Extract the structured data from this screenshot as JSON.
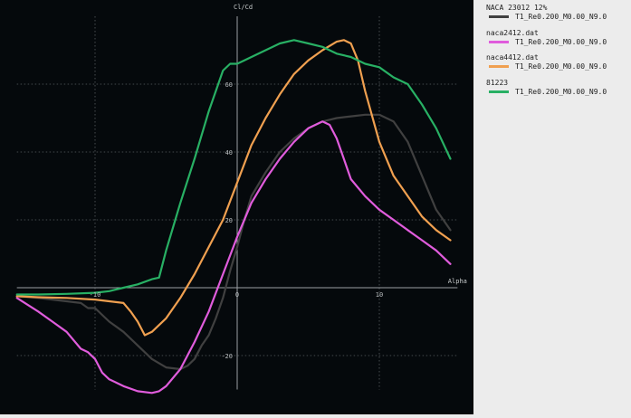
{
  "chart_data": {
    "type": "line",
    "xlabel": "Alpha",
    "ylabel": "Cl/Cd",
    "xlim": [
      -15.5,
      15.5
    ],
    "ylim": [
      -30,
      80
    ],
    "x_ticks": [
      -10,
      0,
      10
    ],
    "y_ticks": [
      -20,
      20,
      60
    ],
    "extra_tick_labels": [
      {
        "axis": "y",
        "value": 40,
        "text": "40"
      }
    ],
    "grid": true,
    "legend_position": "right",
    "background": "#05090c",
    "series": [
      {
        "name": "NACA 23012  12%",
        "polar": "T1_Re0.200_M0.00_N9.0",
        "color": "#404040",
        "x": [
          -15.5,
          -14,
          -12,
          -11,
          -10.5,
          -10,
          -9.5,
          -9,
          -8,
          -7,
          -6,
          -5,
          -4,
          -3.5,
          -3,
          -2.5,
          -2,
          -1.5,
          -1,
          -0.5,
          0,
          0.5,
          1,
          2,
          3,
          4,
          5,
          6,
          7,
          8,
          9,
          10,
          11,
          12,
          13,
          14,
          15
        ],
        "y": [
          -2.5,
          -3,
          -4,
          -4.5,
          -6,
          -6,
          -8,
          -10,
          -13,
          -17,
          -21,
          -23.5,
          -24,
          -23,
          -21,
          -17,
          -14,
          -9,
          -3,
          5,
          12,
          20,
          27,
          34,
          40,
          44,
          47,
          49,
          50,
          50.5,
          51,
          51,
          49,
          43,
          33,
          23,
          17
        ]
      },
      {
        "name": "naca2412.dat",
        "polar": "T1_Re0.200_M0.00_N9.0",
        "color": "#e05cdc",
        "x": [
          -15.5,
          -14,
          -13,
          -12,
          -11,
          -10.5,
          -10,
          -9.5,
          -9,
          -8.5,
          -8,
          -7,
          -6,
          -5.5,
          -5,
          -4,
          -3,
          -2,
          -1,
          0,
          1,
          2,
          3,
          4,
          5,
          6,
          6.5,
          7,
          7.5,
          8,
          9,
          10,
          11,
          12,
          13,
          14,
          15
        ],
        "y": [
          -3,
          -7,
          -10,
          -13,
          -18,
          -19,
          -21,
          -25,
          -27,
          -28,
          -29,
          -30.5,
          -31,
          -30.5,
          -29,
          -24,
          -16,
          -7,
          4,
          15,
          25,
          32,
          38,
          43,
          47,
          49,
          48,
          44,
          38,
          32,
          27,
          23,
          20,
          17,
          14,
          11,
          7
        ]
      },
      {
        "name": "naca4412.dat",
        "polar": "T1_Re0.200_M0.00_N9.0",
        "color": "#f0a050",
        "x": [
          -15.5,
          -14,
          -12,
          -10,
          -9,
          -8,
          -7.5,
          -7,
          -6.5,
          -6,
          -5,
          -4,
          -3,
          -2,
          -1,
          0,
          1,
          2,
          3,
          4,
          5,
          6,
          7,
          7.5,
          8,
          8.5,
          9,
          10,
          11,
          12,
          13,
          14,
          15
        ],
        "y": [
          -2.5,
          -2.8,
          -3,
          -3.5,
          -4,
          -4.5,
          -7,
          -10,
          -14,
          -13,
          -9,
          -3,
          4,
          12,
          20,
          31,
          42,
          50,
          57,
          63,
          67,
          70,
          72.5,
          73,
          72,
          67,
          58,
          43,
          33,
          27,
          21,
          17,
          14
        ]
      },
      {
        "name": "81223",
        "polar": "T1_Re0.200_M0.00_N9.0",
        "color": "#28b064",
        "x": [
          -15.5,
          -14,
          -12,
          -10,
          -9,
          -8,
          -7,
          -6,
          -5.5,
          -5,
          -4,
          -3,
          -2,
          -1,
          -0.5,
          0,
          0.5,
          1,
          2,
          3,
          4,
          5,
          6,
          7,
          8,
          9,
          10,
          11,
          12,
          13,
          14,
          15
        ],
        "y": [
          -2,
          -2,
          -1.8,
          -1.5,
          -1,
          0,
          1,
          2.5,
          3,
          11,
          25,
          38,
          52,
          64,
          66,
          66,
          67,
          68,
          70,
          72,
          73,
          72,
          71,
          69,
          68,
          66,
          65,
          62,
          60,
          54,
          47,
          38
        ]
      }
    ]
  }
}
